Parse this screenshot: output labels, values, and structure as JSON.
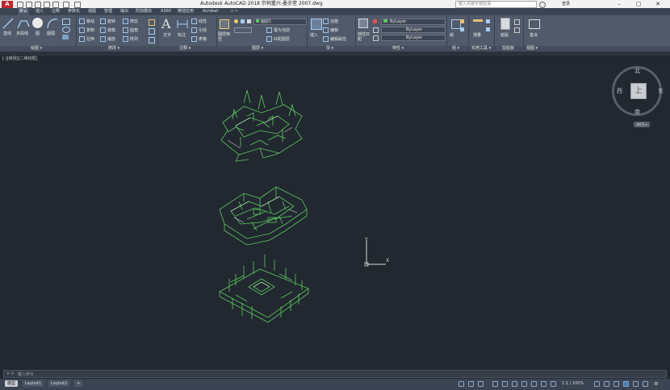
{
  "app": {
    "logo": "A",
    "title": "Autodesk AutoCAD 2018    宗祠重兴-墨亦堂 2007.dwg",
    "search_placeholder": "键入关键字或短语",
    "signin": "登录"
  },
  "ribbon_tabs": [
    "默认",
    "插入",
    "注释",
    "参数化",
    "视图",
    "管理",
    "输出",
    "附加模块",
    "A360",
    "精选应用",
    "Acrobat",
    "▭ •"
  ],
  "active_tab": "默认",
  "draw": {
    "line": "直线",
    "polyline": "多段线",
    "circle": "圆",
    "arc": "圆弧"
  },
  "modify": {
    "move": "移动",
    "rotate": "旋转",
    "trim": "修剪",
    "copy": "复制",
    "mirror": "镜像",
    "fillet": "圆角",
    "stretch": "拉伸",
    "scale": "缩放",
    "array": "阵列"
  },
  "annotation": {
    "text": "文字",
    "dimension": "标注",
    "linear": "线性",
    "leader": "引线",
    "table": "表格"
  },
  "layers": {
    "layer_props": "图层特性",
    "current_layer": "图层1",
    "make_current": "置为当前",
    "match_layer": "匹配图层"
  },
  "block": {
    "insert": "插入",
    "create": "创建",
    "edit": "编辑",
    "edit_attr": "编辑属性"
  },
  "properties": {
    "match": "特性匹配",
    "color": "ByLayer",
    "linetype": "ByLayer",
    "lineweight": "ByLayer"
  },
  "groups": {
    "group": "组"
  },
  "utilities": {
    "measure": "测量"
  },
  "clipboard": {
    "paste": "粘贴"
  },
  "view_panel": {
    "base": "基点"
  },
  "panel_labels": [
    "绘图 ▾",
    "修改 ▾",
    "注释 ▾",
    "图层 ▾",
    "块 ▾",
    "特性 ▾",
    "组 ▾",
    "实用工具 ▾",
    "剪贴板",
    "视图 ▾"
  ],
  "viewport_label": "[-][俯视][二维线框]",
  "viewcube": {
    "top": "上",
    "north": "北",
    "south": "南",
    "east": "东",
    "west": "西",
    "wcs": "WCS ▾"
  },
  "ucs": {
    "x": "X",
    "y": "Y"
  },
  "command_placeholder": "键入命令",
  "layout_tabs": [
    "模型",
    "Layout1",
    "Layout2",
    "+"
  ],
  "active_layout": "模型",
  "status": {
    "scale": "1:1 / 100%"
  },
  "colors": {
    "drawing": "#5ec85e",
    "background": "#212830",
    "accent": "#c3272b"
  }
}
